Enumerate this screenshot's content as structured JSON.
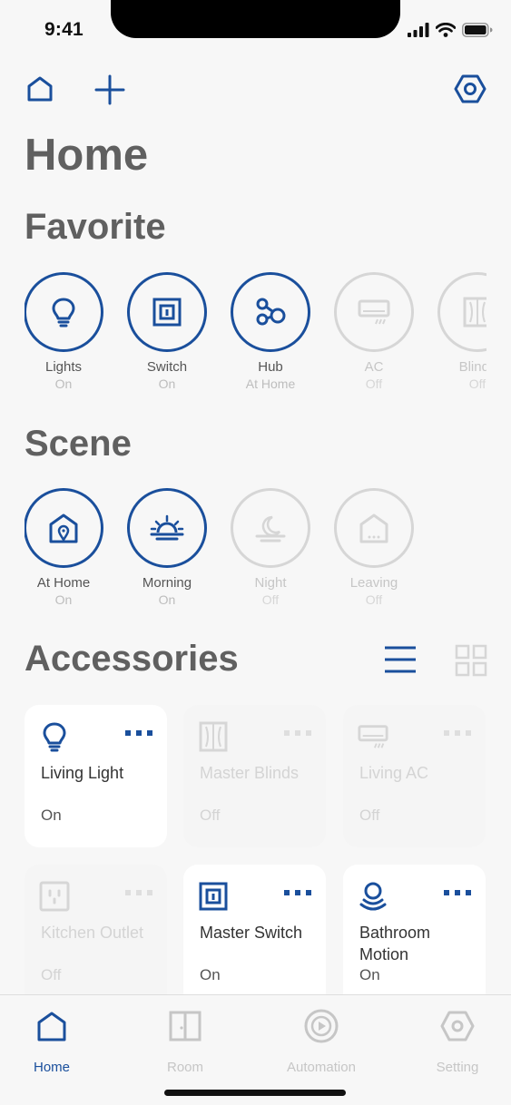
{
  "status_bar": {
    "time": "9:41"
  },
  "page": {
    "title": "Home"
  },
  "favorite": {
    "heading": "Favorite",
    "items": [
      {
        "label": "Lights",
        "status": "On",
        "active": true,
        "icon": "lightbulb-icon"
      },
      {
        "label": "Switch",
        "status": "On",
        "active": true,
        "icon": "switch-icon"
      },
      {
        "label": "Hub",
        "status": "At Home",
        "active": true,
        "icon": "hub-icon"
      },
      {
        "label": "AC",
        "status": "Off",
        "active": false,
        "icon": "ac-icon"
      },
      {
        "label": "Blinds",
        "status": "Off",
        "active": false,
        "icon": "blinds-icon"
      }
    ]
  },
  "scene": {
    "heading": "Scene",
    "items": [
      {
        "label": "At Home",
        "status": "On",
        "active": true,
        "icon": "at-home-icon"
      },
      {
        "label": "Morning",
        "status": "On",
        "active": true,
        "icon": "sunrise-icon"
      },
      {
        "label": "Night",
        "status": "Off",
        "active": false,
        "icon": "moon-icon"
      },
      {
        "label": "Leaving",
        "status": "Off",
        "active": false,
        "icon": "leaving-icon"
      }
    ]
  },
  "accessories": {
    "heading": "Accessories",
    "cards": [
      {
        "name": "Living Light",
        "status": "On",
        "active": true,
        "icon": "lightbulb-icon"
      },
      {
        "name": "Master Blinds",
        "status": "Off",
        "active": false,
        "icon": "blinds-icon"
      },
      {
        "name": "Living AC",
        "status": "Off",
        "active": false,
        "icon": "ac-icon"
      },
      {
        "name": "Kitchen Outlet",
        "status": "Off",
        "active": false,
        "icon": "outlet-icon"
      },
      {
        "name": "Master Switch",
        "status": "On",
        "active": true,
        "icon": "switch-icon"
      },
      {
        "name": "Bathroom Motion",
        "status": "On",
        "active": true,
        "icon": "motion-sensor-icon"
      }
    ]
  },
  "tab_bar": {
    "tabs": [
      {
        "label": "Home",
        "active": true,
        "icon": "home-icon"
      },
      {
        "label": "Room",
        "active": false,
        "icon": "room-icon"
      },
      {
        "label": "Automation",
        "active": false,
        "icon": "automation-icon"
      },
      {
        "label": "Setting",
        "active": false,
        "icon": "setting-icon"
      }
    ]
  },
  "colors": {
    "accent": "#1a4f9c",
    "inactive": "#d6d6d6",
    "background": "#f7f7f7"
  }
}
